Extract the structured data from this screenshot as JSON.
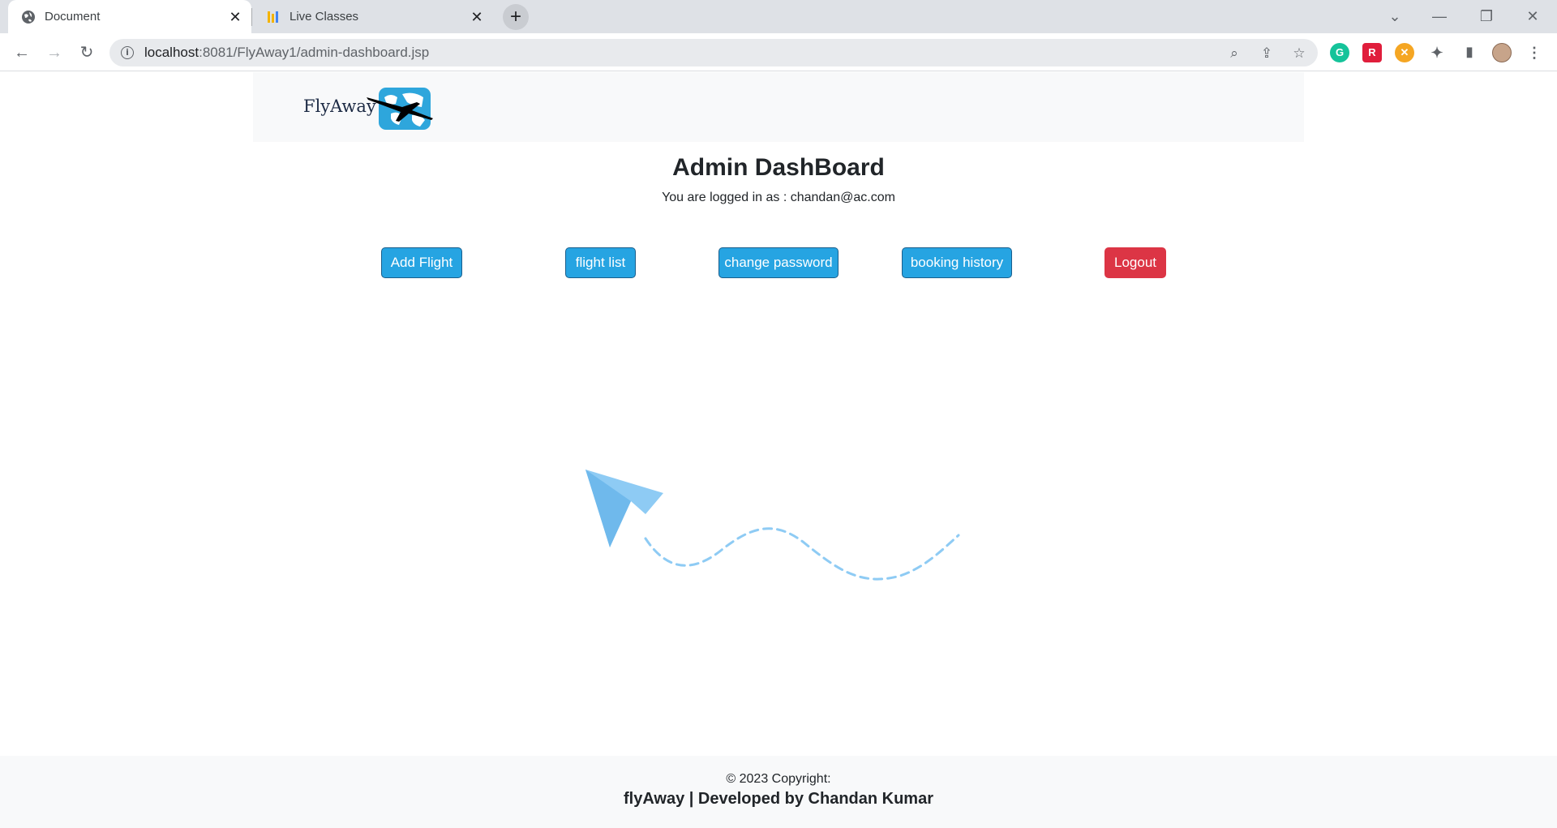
{
  "browser": {
    "tabs": [
      {
        "title": "Document",
        "active": true,
        "icon": "globe-icon"
      },
      {
        "title": "Live Classes",
        "active": false,
        "icon": "bars-icon"
      }
    ],
    "url_host": "localhost",
    "url_rest": ":8081/FlyAway1/admin-dashboard.jsp",
    "close_glyph": "✕",
    "newtab_glyph": "+"
  },
  "navbar": {
    "brand": "FlyAway"
  },
  "main": {
    "title": "Admin DashBoard",
    "login_text": "You are logged in as : chandan@ac.com",
    "buttons": {
      "add_flight": "Add Flight",
      "flight_list": "flight list",
      "change_password": "change password",
      "booking_history": "booking history",
      "logout": "Logout"
    }
  },
  "footer": {
    "copyright": "© 2023 Copyright:",
    "credit": "flyAway | Developed by Chandan Kumar"
  },
  "colors": {
    "primary_button": "#26a4e2",
    "danger_button": "#dc3545",
    "paper_plane": "#8ecbf4",
    "navbar_bg": "#f8f9fa"
  }
}
